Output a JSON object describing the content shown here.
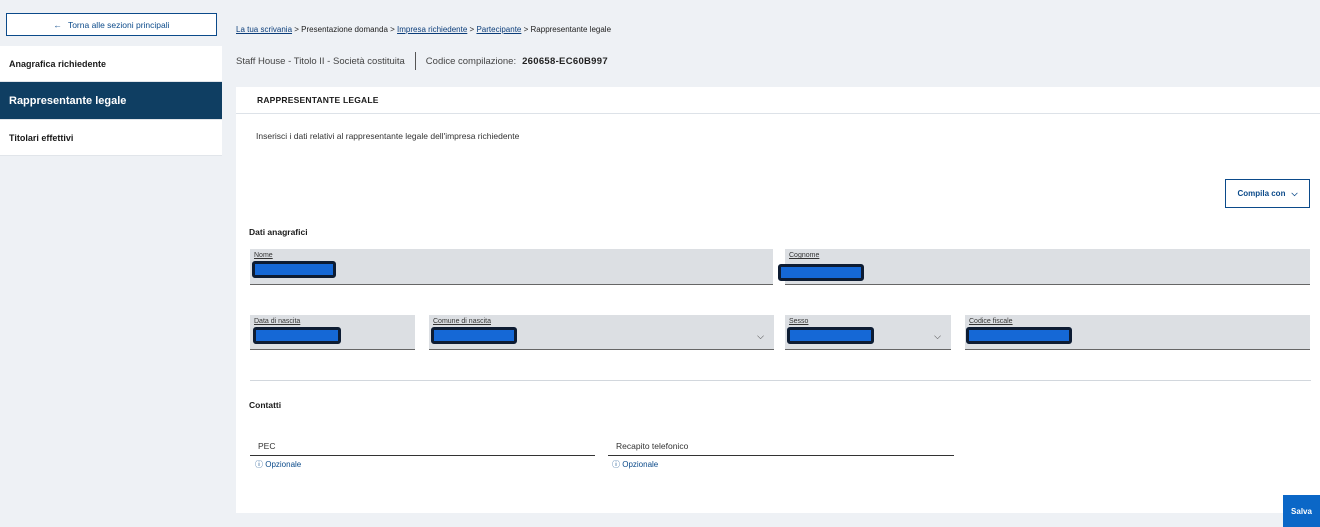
{
  "sidebar": {
    "back_label": "Torna alle sezioni principali",
    "back_icon": "arrow-left-icon",
    "items": [
      {
        "label": "Anagrafica richiedente"
      },
      {
        "label": "Rappresentante legale",
        "active": true
      },
      {
        "label": "Titolari effettivi"
      }
    ]
  },
  "breadcrumb": {
    "items": [
      "La tua scrivania",
      "Presentazione domanda",
      "Impresa richiedente",
      "Partecipante",
      "Rappresentante legale"
    ],
    "separator": ">"
  },
  "subheader": {
    "context": "Staff House - Titolo II  -  Società costituita",
    "code_label": "Codice compilazione:",
    "code_value": "260658-EC60B997"
  },
  "card": {
    "title": "RAPPRESENTANTE LEGALE",
    "intro": "Inserisci i dati relativi al rappresentante legale dell'impresa richiedente",
    "compila_label": "Compila con",
    "sections": {
      "anagrafici": "Dati anagrafici",
      "contatti": "Contatti"
    },
    "fields": {
      "nome": "Nome",
      "cognome": "Cognome",
      "data_nascita": "Data di nascita",
      "comune_nascita": "Comune di nascita",
      "sesso": "Sesso",
      "codice_fiscale": "Codice fiscale",
      "pec": "PEC",
      "recapito": "Recapito telefonico"
    },
    "optional_hint": "Opzionale",
    "info_icon": "ⓘ"
  },
  "save_label": "Salva",
  "colors": {
    "primary": "#0b4a8a",
    "sidebar_active": "#0f3e62",
    "save_button": "#0b67c7",
    "redaction": "#1568d6"
  }
}
